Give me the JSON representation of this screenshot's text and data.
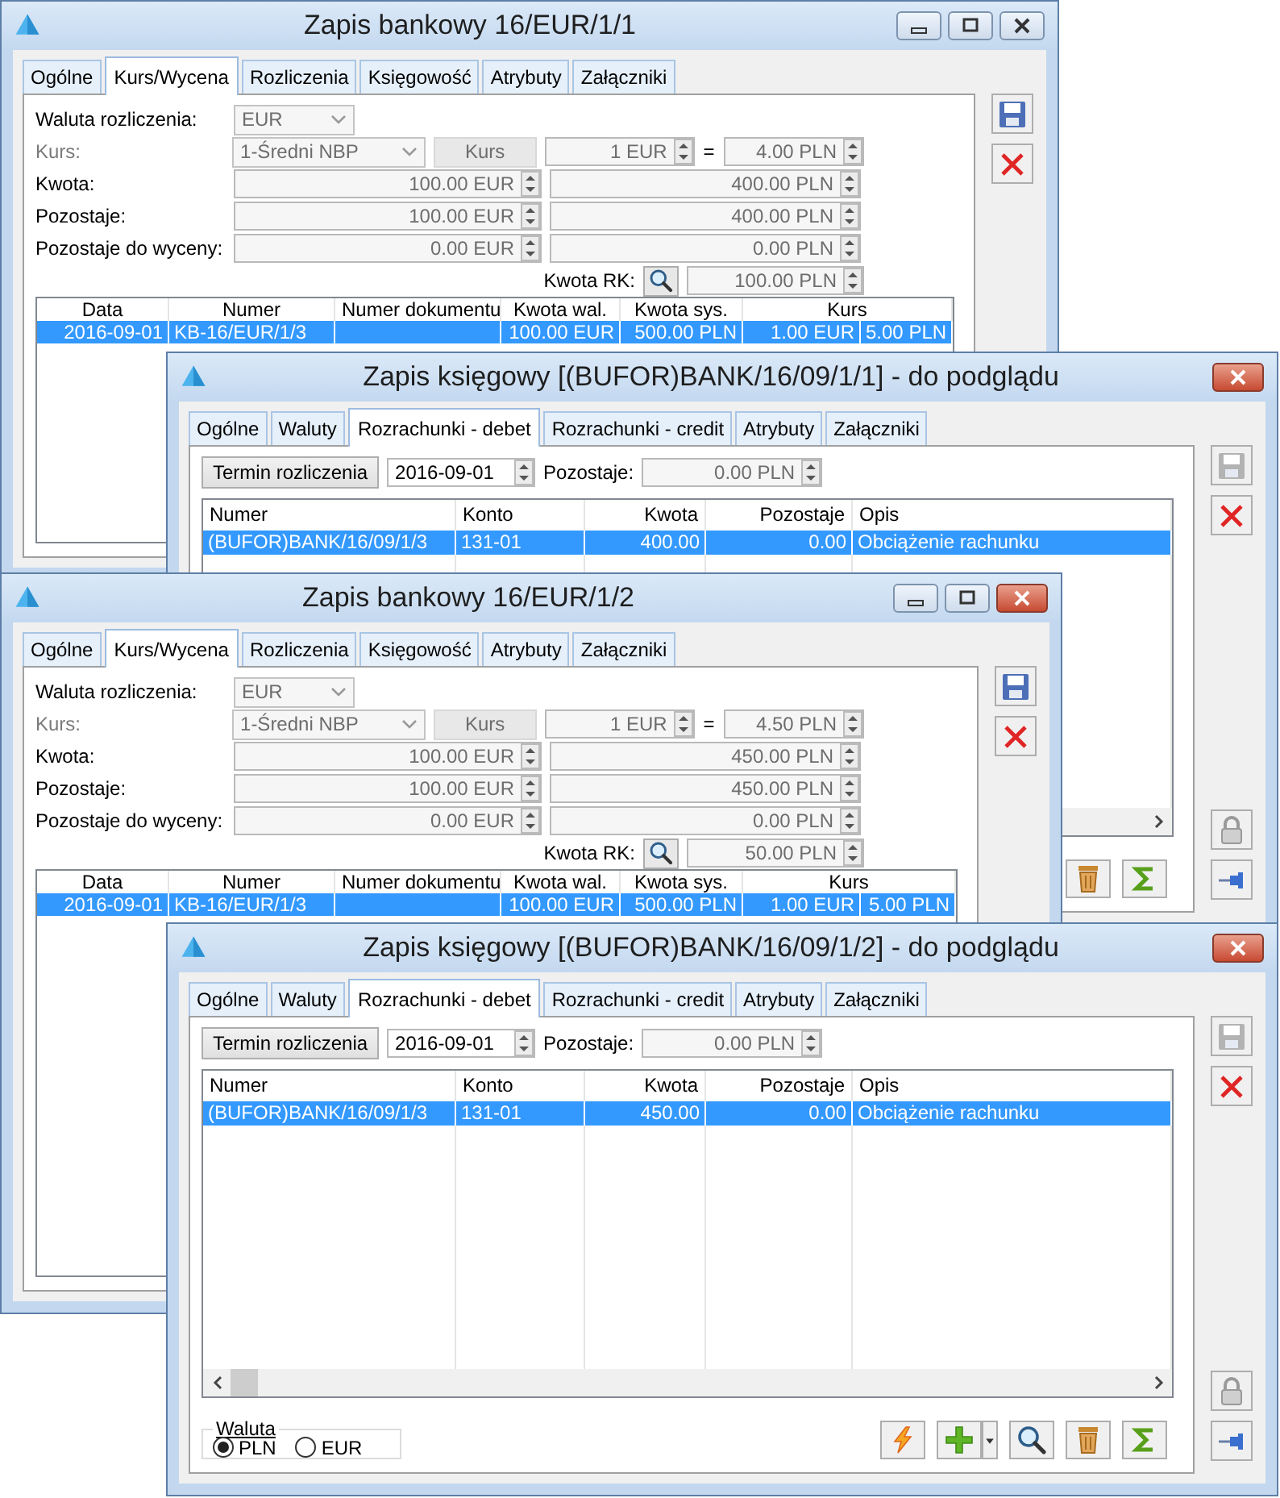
{
  "windows": [
    {
      "kind": "bank",
      "title": "Zapis bankowy 16/EUR/1/1",
      "active": false,
      "controls": [
        {
          "kind": "minimize"
        },
        {
          "kind": "maximize"
        },
        {
          "kind": "close"
        }
      ],
      "tabs": [
        {
          "label": "Ogólne",
          "selected": false
        },
        {
          "label": "Kurs/Wycena",
          "selected": true
        },
        {
          "label": "Rozliczenia",
          "selected": false
        },
        {
          "label": "Księgowość",
          "selected": false
        },
        {
          "label": "Atrybuty",
          "selected": false
        },
        {
          "label": "Załączniki",
          "selected": false
        }
      ],
      "form": {
        "currency": {
          "label": "Waluta rozliczenia:",
          "value": "EUR"
        },
        "rate": {
          "label": "Kurs:",
          "disabled": true,
          "type": "1-Średni NBP",
          "button": "Kurs",
          "from": "1 EUR",
          "equals": "=",
          "to": "4.00 PLN"
        },
        "amounts": [
          {
            "label": "Kwota:",
            "value": "100.00 EUR",
            "value_sys": "400.00 PLN"
          },
          {
            "label": "Pozostaje:",
            "value": "100.00 EUR",
            "value_sys": "400.00 PLN"
          },
          {
            "label": "Pozostaje do wyceny:",
            "value": "0.00 EUR",
            "value_sys": "0.00 PLN"
          }
        ],
        "cash": {
          "label": "Kwota RK:",
          "value": "100.00 PLN"
        }
      },
      "table": {
        "columns": [
          "Data",
          "Numer",
          "Numer dokumentu",
          "Kwota wal.",
          "Kwota sys.",
          "Kurs"
        ],
        "rows": [
          {
            "selected": true,
            "cells": [
              "2016-09-01",
              "KB-16/EUR/1/3",
              null,
              "100.00 EUR",
              "500.00 PLN",
              "1.00 EUR",
              "5.00 PLN"
            ]
          }
        ]
      },
      "side_buttons": [
        {
          "kind": "save",
          "disabled": false
        },
        {
          "kind": "delete"
        }
      ]
    },
    {
      "kind": "ledger",
      "title": "Zapis księgowy [(BUFOR)BANK/16/09/1/1] - do podglądu",
      "active": true,
      "controls": [
        {
          "kind": "close"
        }
      ],
      "tabs": [
        {
          "label": "Ogólne",
          "selected": false
        },
        {
          "label": "Waluty",
          "selected": false
        },
        {
          "label": "Rozrachunki - debet",
          "selected": true
        },
        {
          "label": "Rozrachunki - credit",
          "selected": false
        },
        {
          "label": "Atrybuty",
          "selected": false
        },
        {
          "label": "Załączniki",
          "selected": false
        }
      ],
      "top": {
        "due_button": "Termin rozliczenia",
        "due_date": "2016-09-01",
        "remaining_label": "Pozostaje:",
        "remaining": "0.00 PLN"
      },
      "table": {
        "columns": [
          "Numer",
          "Konto",
          "Kwota",
          "Pozostaje",
          "Opis"
        ],
        "rows": [
          {
            "selected": true,
            "cells": [
              "(BUFOR)BANK/16/09/1/3",
              "131-01",
              "400.00",
              "0.00",
              "Obciążenie rachunku"
            ]
          }
        ]
      },
      "toolbar": [
        {
          "kind": "trash"
        },
        {
          "kind": "sum"
        }
      ],
      "side_buttons": [
        {
          "kind": "save",
          "disabled": true
        },
        {
          "kind": "delete"
        }
      ],
      "side_bottom": [
        {
          "kind": "lock"
        },
        {
          "kind": "pin"
        }
      ]
    },
    {
      "kind": "bank",
      "title": "Zapis bankowy 16/EUR/1/2",
      "active": true,
      "controls": [
        {
          "kind": "minimize"
        },
        {
          "kind": "maximize"
        },
        {
          "kind": "close"
        }
      ],
      "tabs": [
        {
          "label": "Ogólne",
          "selected": false
        },
        {
          "label": "Kurs/Wycena",
          "selected": true
        },
        {
          "label": "Rozliczenia",
          "selected": false
        },
        {
          "label": "Księgowość",
          "selected": false
        },
        {
          "label": "Atrybuty",
          "selected": false
        },
        {
          "label": "Załączniki",
          "selected": false
        }
      ],
      "form": {
        "currency": {
          "label": "Waluta rozliczenia:",
          "value": "EUR"
        },
        "rate": {
          "label": "Kurs:",
          "disabled": true,
          "type": "1-Średni NBP",
          "button": "Kurs",
          "from": "1 EUR",
          "equals": "=",
          "to": "4.50 PLN"
        },
        "amounts": [
          {
            "label": "Kwota:",
            "value": "100.00 EUR",
            "value_sys": "450.00 PLN"
          },
          {
            "label": "Pozostaje:",
            "value": "100.00 EUR",
            "value_sys": "450.00 PLN"
          },
          {
            "label": "Pozostaje do wyceny:",
            "value": "0.00 EUR",
            "value_sys": "0.00 PLN"
          }
        ],
        "cash": {
          "label": "Kwota RK:",
          "value": "50.00 PLN"
        }
      },
      "table": {
        "columns": [
          "Data",
          "Numer",
          "Numer dokumentu",
          "Kwota wal.",
          "Kwota sys.",
          "Kurs"
        ],
        "rows": [
          {
            "selected": true,
            "cells": [
              "2016-09-01",
              "KB-16/EUR/1/3",
              null,
              "100.00 EUR",
              "500.00 PLN",
              "1.00 EUR",
              "5.00 PLN"
            ]
          }
        ]
      },
      "side_buttons": [
        {
          "kind": "save",
          "disabled": false
        },
        {
          "kind": "delete"
        }
      ]
    },
    {
      "kind": "ledger",
      "title": "Zapis księgowy [(BUFOR)BANK/16/09/1/2] - do podglądu",
      "active": true,
      "controls": [
        {
          "kind": "close"
        }
      ],
      "tabs": [
        {
          "label": "Ogólne",
          "selected": false
        },
        {
          "label": "Waluty",
          "selected": false
        },
        {
          "label": "Rozrachunki - debet",
          "selected": true
        },
        {
          "label": "Rozrachunki - credit",
          "selected": false
        },
        {
          "label": "Atrybuty",
          "selected": false
        },
        {
          "label": "Załączniki",
          "selected": false
        }
      ],
      "top": {
        "due_button": "Termin rozliczenia",
        "due_date": "2016-09-01",
        "remaining_label": "Pozostaje:",
        "remaining": "0.00 PLN"
      },
      "table": {
        "columns": [
          "Numer",
          "Konto",
          "Kwota",
          "Pozostaje",
          "Opis"
        ],
        "rows": [
          {
            "selected": true,
            "cells": [
              "(BUFOR)BANK/16/09/1/3",
              "131-01",
              "450.00",
              "0.00",
              "Obciążenie rachunku"
            ]
          }
        ]
      },
      "currency_group": {
        "label": "Waluta",
        "options": [
          {
            "label": "PLN",
            "selected": true
          },
          {
            "label": "EUR",
            "selected": false
          }
        ]
      },
      "toolbar": [
        {
          "kind": "flash"
        },
        {
          "kind": "add"
        },
        {
          "kind": "dropdown"
        },
        {
          "kind": "search"
        },
        {
          "kind": "trash"
        },
        {
          "kind": "sum"
        }
      ],
      "side_buttons": [
        {
          "kind": "save",
          "disabled": true
        },
        {
          "kind": "delete"
        }
      ],
      "side_bottom": [
        {
          "kind": "lock"
        },
        {
          "kind": "pin"
        }
      ]
    }
  ]
}
